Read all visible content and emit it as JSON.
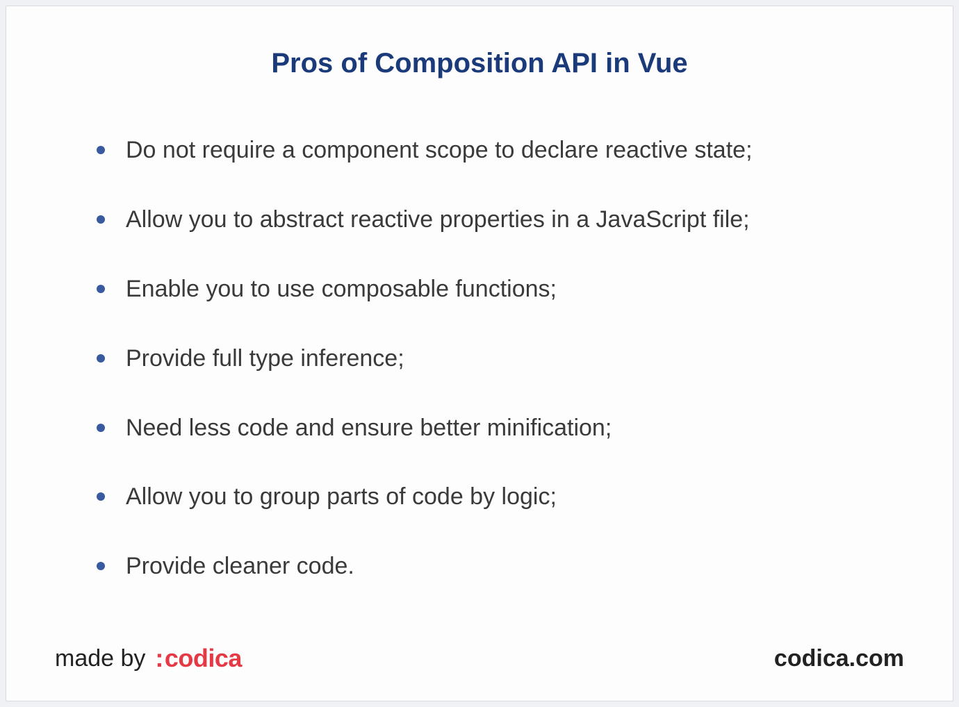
{
  "title": "Pros of Composition API in Vue",
  "items": [
    "Do not require a component scope to declare reactive state;",
    "Allow you to abstract reactive properties in a JavaScript file;",
    "Enable you to use composable functions;",
    "Provide full type inference;",
    "Need less code and ensure better minification;",
    "Allow you to group parts of code by logic;",
    "Provide cleaner code."
  ],
  "footer": {
    "made_by": "made by",
    "logo_colon": ":",
    "logo_name": "codica",
    "site": "codica.com"
  }
}
